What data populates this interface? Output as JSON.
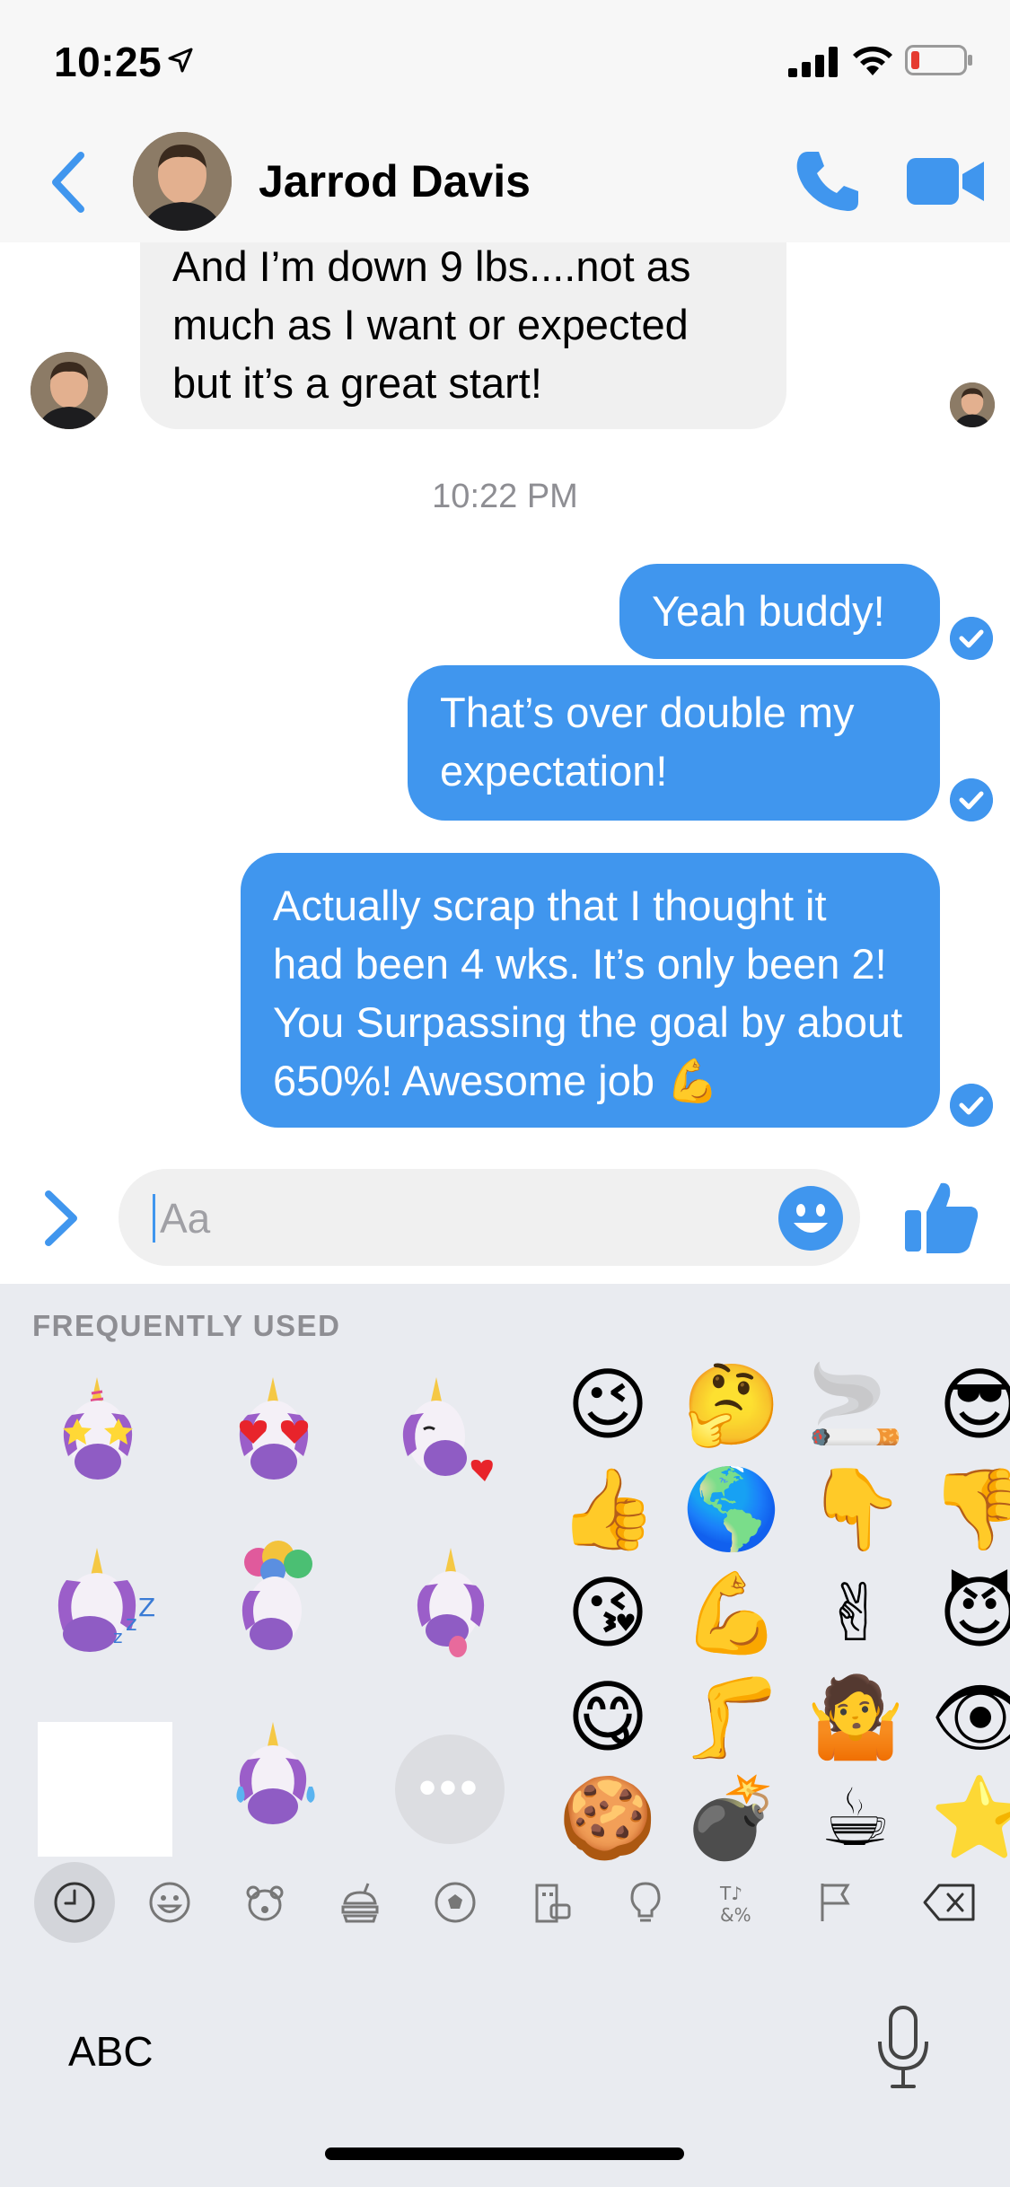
{
  "status_bar": {
    "time": "10:25"
  },
  "header": {
    "contact_name": "Jarrod Davis"
  },
  "messages": {
    "incoming_1": "And I’m down 9 lbs....not as much as I want or expected but it’s a great start!",
    "timestamp": "10:22 PM",
    "outgoing_1": "Yeah buddy!",
    "outgoing_2": "That’s over double my expectation!",
    "outgoing_3": "Actually scrap that I thought it had been 4 wks. It’s only been 2! You Surpassing the goal by about 650%! Awesome job 💪"
  },
  "composer": {
    "placeholder": "Aa"
  },
  "keyboard": {
    "section_title": "FREQUENTLY USED",
    "emoji_rows": [
      [
        "😉",
        "🤔",
        "🚬",
        "😎"
      ],
      [
        "👍",
        "🌎",
        "👇",
        "👎"
      ],
      [
        "😘",
        "💪",
        "✌",
        "😈"
      ],
      [
        "😋",
        "🦵",
        "🤷",
        "👁"
      ],
      [
        "🍪",
        "💣",
        "☕",
        "⭐"
      ]
    ],
    "memoji_labels": [
      "unicorn-starstruck",
      "unicorn-heart-eyes",
      "unicorn-kiss",
      "unicorn-sleeping",
      "unicorn-mind-blown",
      "unicorn-tongue",
      "unicorn-tears-of-joy"
    ],
    "more_label": "•••",
    "abc_label": "ABC",
    "categories": [
      "recent-icon",
      "smileys-icon",
      "animals-icon",
      "food-icon",
      "activity-icon",
      "travel-icon",
      "objects-icon",
      "symbols-icon",
      "flags-icon",
      "delete-icon"
    ]
  },
  "colors": {
    "accent": "#4096ee",
    "incoming_bubble": "#f0f0f0",
    "keyboard_bg": "#e9ebf0"
  }
}
